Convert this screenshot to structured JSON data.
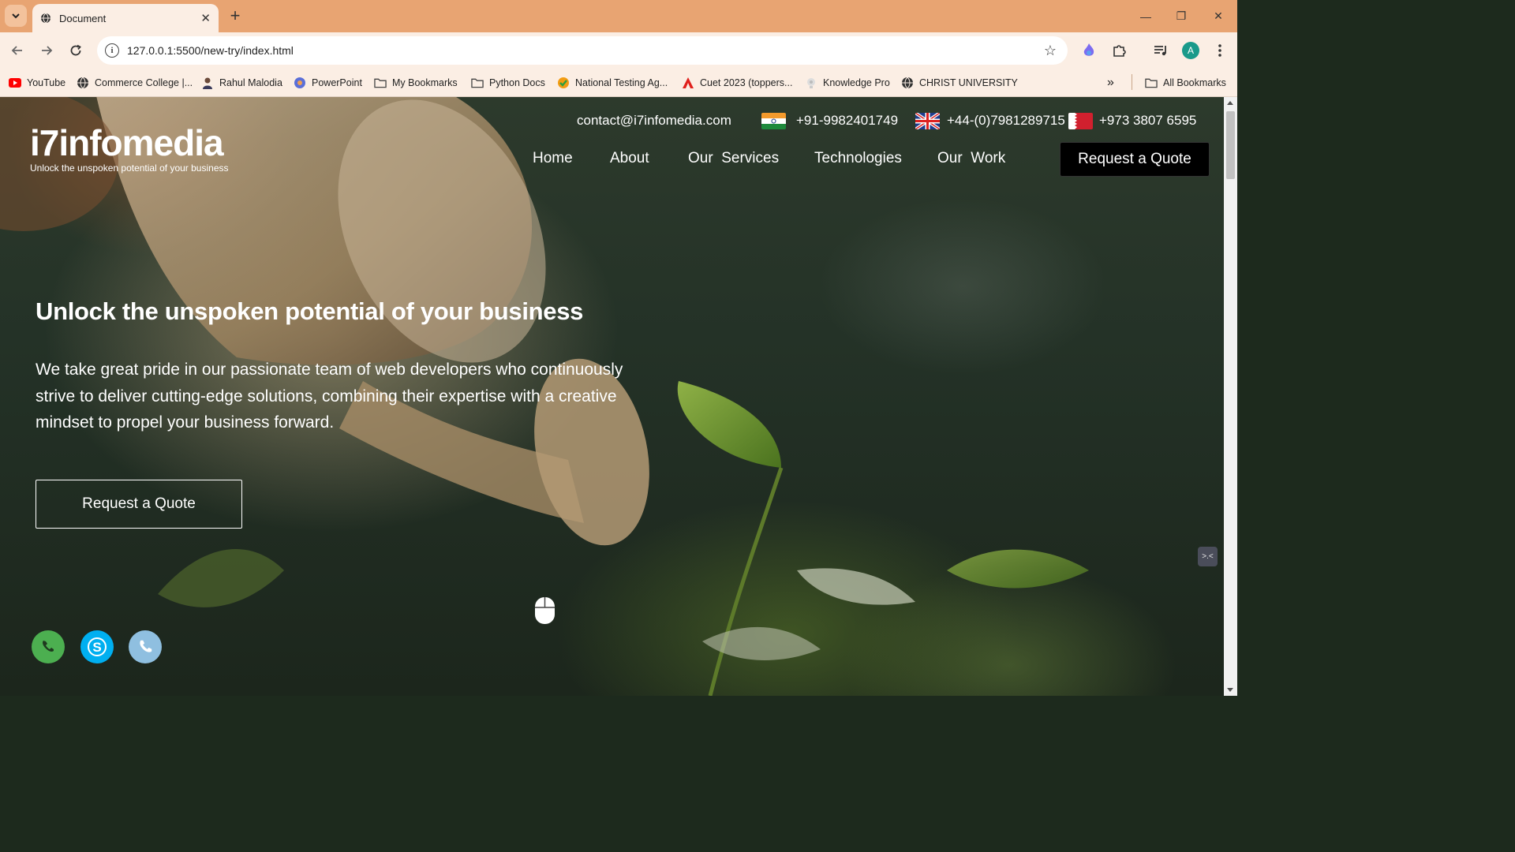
{
  "browser": {
    "tab_title": "Document",
    "tab_close": "✕",
    "new_tab": "+",
    "url": "127.0.0.1:5500/new-try/index.html",
    "window_controls": [
      "—",
      "❐",
      "✕"
    ],
    "avatar_letter": "A",
    "bookmarks": [
      {
        "label": "YouTube",
        "icon": "youtube-icon"
      },
      {
        "label": "Commerce College |...",
        "icon": "globe-icon"
      },
      {
        "label": "Rahul Malodia",
        "icon": "person-icon"
      },
      {
        "label": "PowerPoint",
        "icon": "powerpoint-icon"
      },
      {
        "label": "My Bookmarks",
        "icon": "folder-icon"
      },
      {
        "label": "Python Docs",
        "icon": "folder-icon"
      },
      {
        "label": "National Testing Ag...",
        "icon": "nta-icon"
      },
      {
        "label": "Cuet 2023 (toppers...",
        "icon": "adobe-icon"
      },
      {
        "label": "Knowledge Pro",
        "icon": "knowledge-icon"
      },
      {
        "label": "CHRIST UNIVERSITY",
        "icon": "globe-icon"
      }
    ],
    "more_bookmarks": "»",
    "all_bookmarks": "All Bookmarks",
    "accent": "#e8a472"
  },
  "site": {
    "logo_text": "i7infomedia",
    "logo_tagline": "Unlock the unspoken potential of your business",
    "email": "contact@i7infomedia.com",
    "phones": [
      {
        "flag": "india-flag",
        "number": "+91-9982401749"
      },
      {
        "flag": "uk-flag",
        "number": "+44-(0)7981289715"
      },
      {
        "flag": "bahrain-flag",
        "number": "+973 3807 6595"
      }
    ],
    "nav": [
      "Home",
      "About",
      "Our  Services",
      "Technologies",
      "Our  Work"
    ],
    "nav_cta": "Request a Quote",
    "hero": {
      "title": "Unlock the unspoken potential of your business",
      "text": "We take great pride in our passionate team of web developers who continuously strive to deliver cutting-edge solutions, combining their expertise with a creative mindset to propel your business forward.",
      "cta": "Request a Quote"
    },
    "floating": [
      "whatsapp-icon",
      "skype-icon",
      "phone-icon"
    ],
    "side_widget": ">.<",
    "colors": {
      "whatsapp": "#4caf50",
      "skype": "#00aff0",
      "phone": "#8fbfe0"
    }
  }
}
